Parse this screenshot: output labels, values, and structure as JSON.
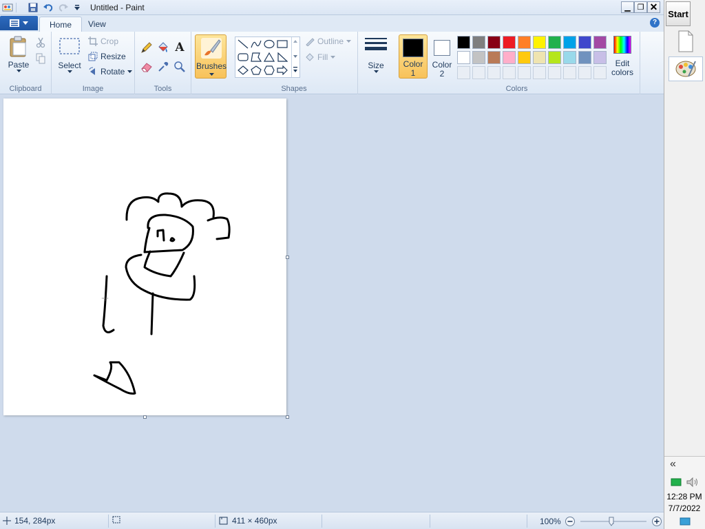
{
  "window": {
    "title": "Untitled - Paint",
    "min_glyph": "▁",
    "max_glyph": "❐",
    "close_glyph": "✕"
  },
  "tabs": {
    "app_menu_icon": "app-menu-icon",
    "home": "Home",
    "view": "View",
    "help_glyph": "?"
  },
  "clipboard": {
    "paste_label": "Paste",
    "group_label": "Clipboard"
  },
  "image": {
    "select_label": "Select",
    "crop_label": "Crop",
    "resize_label": "Resize",
    "rotate_label": "Rotate",
    "group_label": "Image"
  },
  "tools": {
    "group_label": "Tools",
    "text_glyph": "A"
  },
  "brushes": {
    "label": "Brushes"
  },
  "shapes": {
    "outline_label": "Outline",
    "fill_label": "Fill",
    "group_label": "Shapes"
  },
  "size": {
    "label": "Size"
  },
  "colors": {
    "color1_label": "Color",
    "color1_num": "1",
    "color2_label": "Color",
    "color2_num": "2",
    "edit_label_1": "Edit",
    "edit_label_2": "colors",
    "group_label": "Colors",
    "color1_value": "#000000",
    "color2_value": "#ffffff",
    "palette_row1": [
      "#000000",
      "#7f7f7f",
      "#880015",
      "#ed1c24",
      "#ff7f27",
      "#fff200",
      "#22b14c",
      "#00a2e8",
      "#3f48cc",
      "#a349a4"
    ],
    "palette_row2": [
      "#ffffff",
      "#c3c3c3",
      "#b97a57",
      "#ffaec9",
      "#ffc90e",
      "#efe4b0",
      "#b5e61d",
      "#99d9ea",
      "#7092be",
      "#c8bfe7"
    ]
  },
  "status": {
    "cursor_pos": "154, 284px",
    "canvas_size": "411 × 460px",
    "zoom": "100%"
  },
  "taskbar": {
    "start_label": "Start",
    "collapse_glyph": "«",
    "time": "12:28 PM",
    "date": "7/7/2022"
  }
}
